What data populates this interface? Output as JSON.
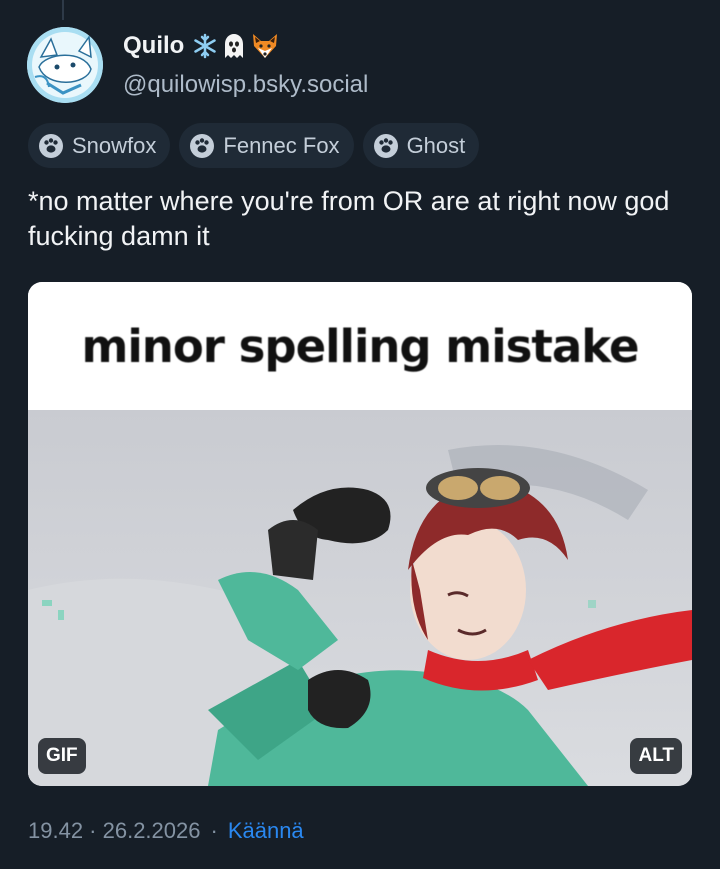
{
  "author": {
    "display_name": "Quilo",
    "emojis": [
      "snowflake",
      "ghost",
      "fox"
    ],
    "handle": "@quilowisp.bsky.social"
  },
  "tags": [
    {
      "label": "Snowfox",
      "icon": "paw-icon"
    },
    {
      "label": "Fennec Fox",
      "icon": "paw-icon"
    },
    {
      "label": "Ghost",
      "icon": "paw-icon"
    }
  ],
  "post": {
    "text": "*no matter where you're from OR are at right now god fucking damn it"
  },
  "media": {
    "caption": "minor spelling mistake",
    "gif_badge": "GIF",
    "alt_badge": "ALT"
  },
  "meta": {
    "timestamp": "19.42 · 26.2.2026",
    "separator": "·",
    "translate_label": "Käännä"
  },
  "colors": {
    "background": "#161e27",
    "tag_bg": "#1f2a36",
    "link": "#2a88f0",
    "muted": "#8493a3"
  }
}
